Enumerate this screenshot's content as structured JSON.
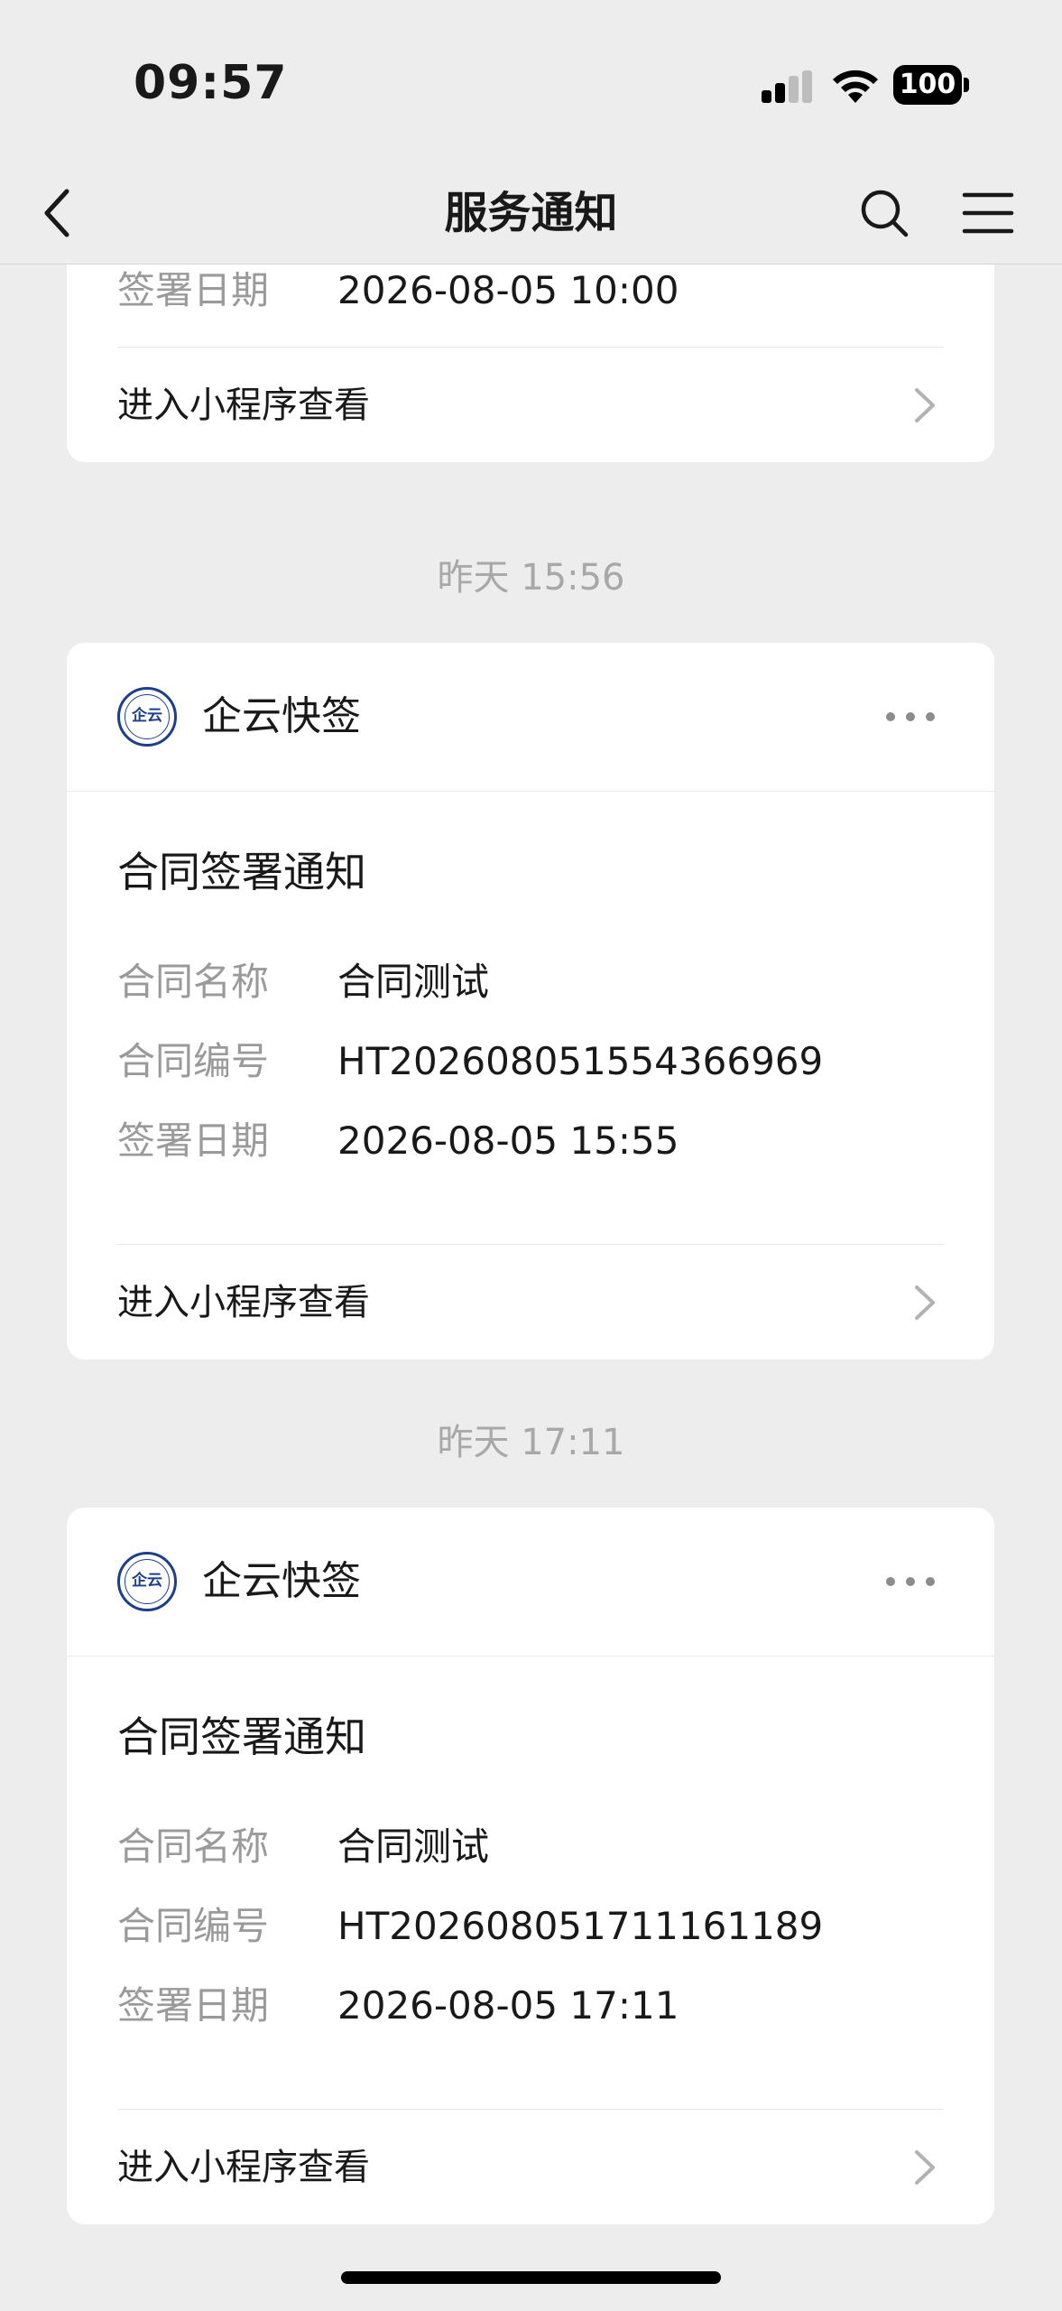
{
  "status_bar": {
    "time": "09:57",
    "battery": "100"
  },
  "nav": {
    "title": "服务通知"
  },
  "previous_card": {
    "partial_label": "签署日期",
    "partial_value": "2026-08-05 10:00",
    "link_label": "进入小程序查看"
  },
  "messages": [
    {
      "timestamp": "昨天 15:56",
      "sender": "企云快签",
      "logo_text": "企云",
      "title": "合同签署通知",
      "fields": [
        {
          "label": "合同名称",
          "value": "合同测试"
        },
        {
          "label": "合同编号",
          "value": "HT20260805155436​6969"
        },
        {
          "label": "签署日期",
          "value": "2026-08-05 15:55"
        }
      ],
      "link_label": "进入小程序查看"
    },
    {
      "timestamp": "昨天 17:11",
      "sender": "企云快签",
      "logo_text": "企云",
      "title": "合同签署通知",
      "fields": [
        {
          "label": "合同名称",
          "value": "合同测试"
        },
        {
          "label": "合同编号",
          "value": "HT20260805171116​1189"
        },
        {
          "label": "签署日期",
          "value": "2026-08-05 17:11"
        }
      ],
      "link_label": "进入小程序查看"
    }
  ],
  "colors": {
    "background": "#ededed",
    "card": "#ffffff",
    "logo_blue": "#1d3f8a",
    "label_gray": "#9a9a9a"
  }
}
